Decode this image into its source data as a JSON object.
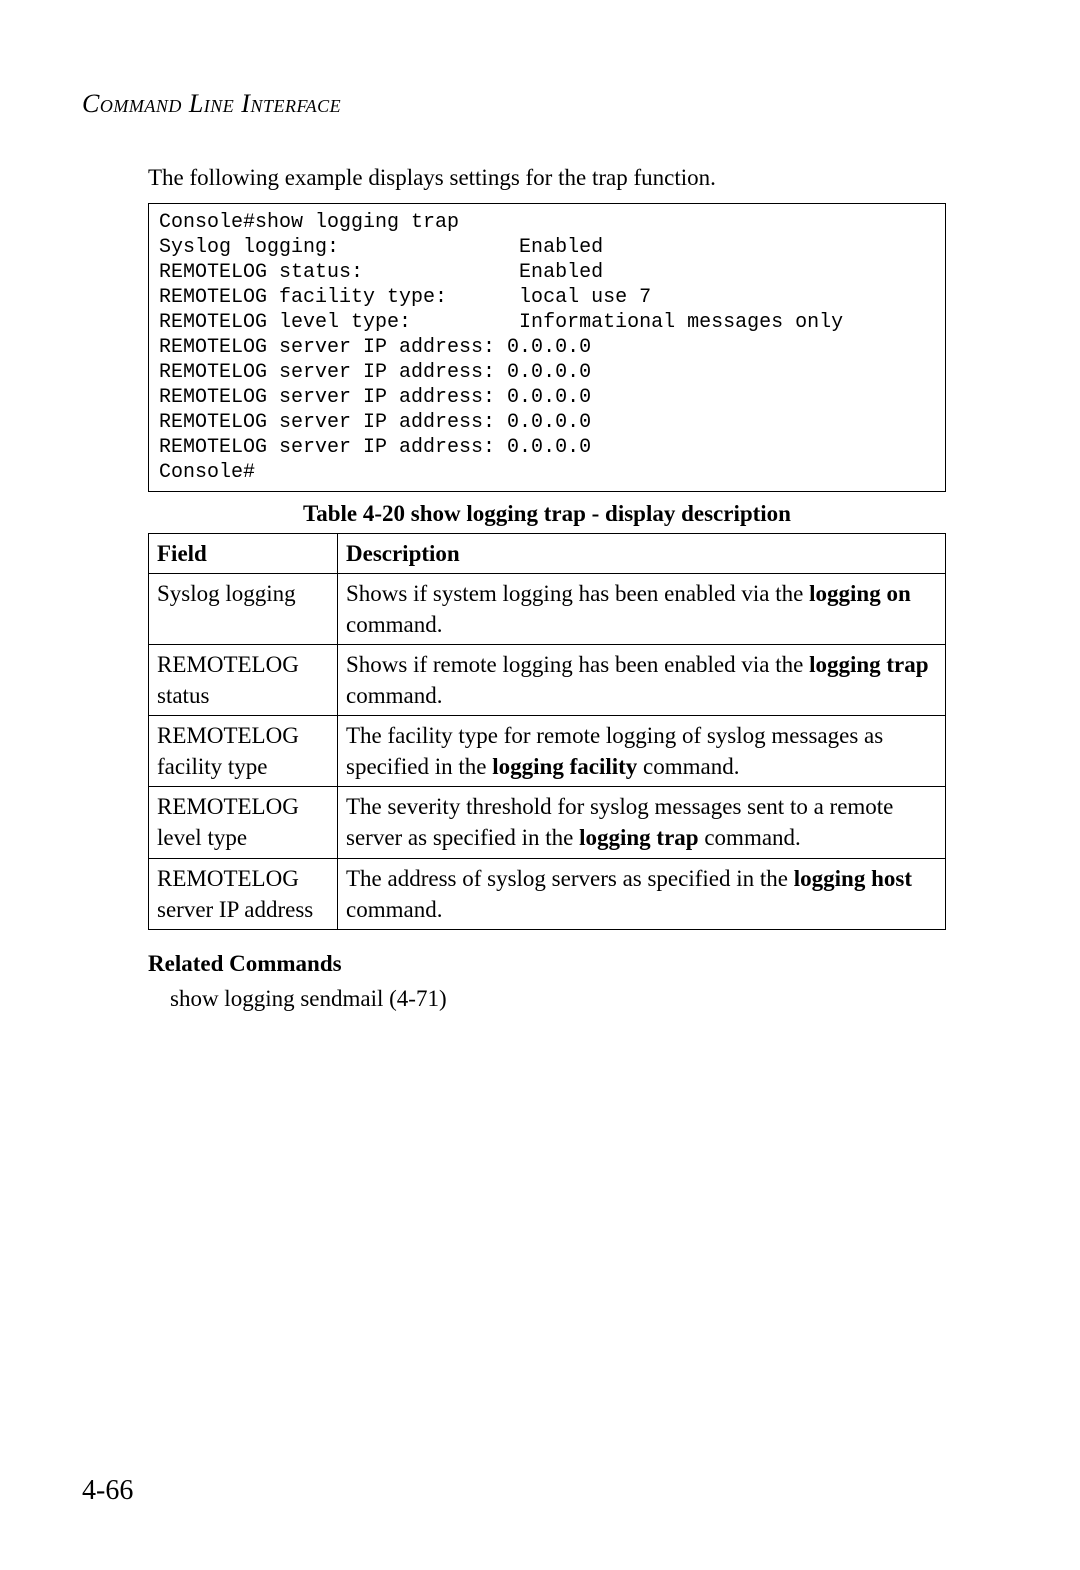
{
  "header": "Command Line Interface",
  "intro": "The following example displays settings for the trap function.",
  "console_lines": [
    "Console#show logging trap",
    "Syslog logging:               Enabled",
    "REMOTELOG status:             Enabled",
    "REMOTELOG facility type:      local use 7",
    "REMOTELOG level type:         Informational messages only",
    "REMOTELOG server IP address: 0.0.0.0",
    "REMOTELOG server IP address: 0.0.0.0",
    "REMOTELOG server IP address: 0.0.0.0",
    "REMOTELOG server IP address: 0.0.0.0",
    "REMOTELOG server IP address: 0.0.0.0",
    "Console#"
  ],
  "table": {
    "caption": "Table 4-20  show logging trap - display description",
    "head": {
      "field": "Field",
      "desc": "Description"
    },
    "rows": [
      {
        "field": "Syslog logging",
        "d1": "Shows if system logging has been enabled via the ",
        "db1": "logging on",
        "d2": " command."
      },
      {
        "field": "REMOTELOG status",
        "d1": "Shows if remote logging has been enabled via the ",
        "db1": "logging trap",
        "d2": " command."
      },
      {
        "field": "REMOTELOG facility type",
        "d1": "The facility type for remote logging of syslog messages as specified in the ",
        "db1": "logging facility",
        "d2": " command."
      },
      {
        "field": "REMOTELOG level type",
        "d1": "The severity threshold for syslog messages sent to a remote server as specified in the ",
        "db1": "logging trap",
        "d2": " command."
      },
      {
        "field": "REMOTELOG server IP address",
        "d1": "The address of syslog servers as specified in the ",
        "db1": "logging host",
        "d2": " command."
      }
    ]
  },
  "related": {
    "heading": "Related Commands",
    "item": "show logging sendmail (4-71)"
  },
  "page_number": "4-66"
}
